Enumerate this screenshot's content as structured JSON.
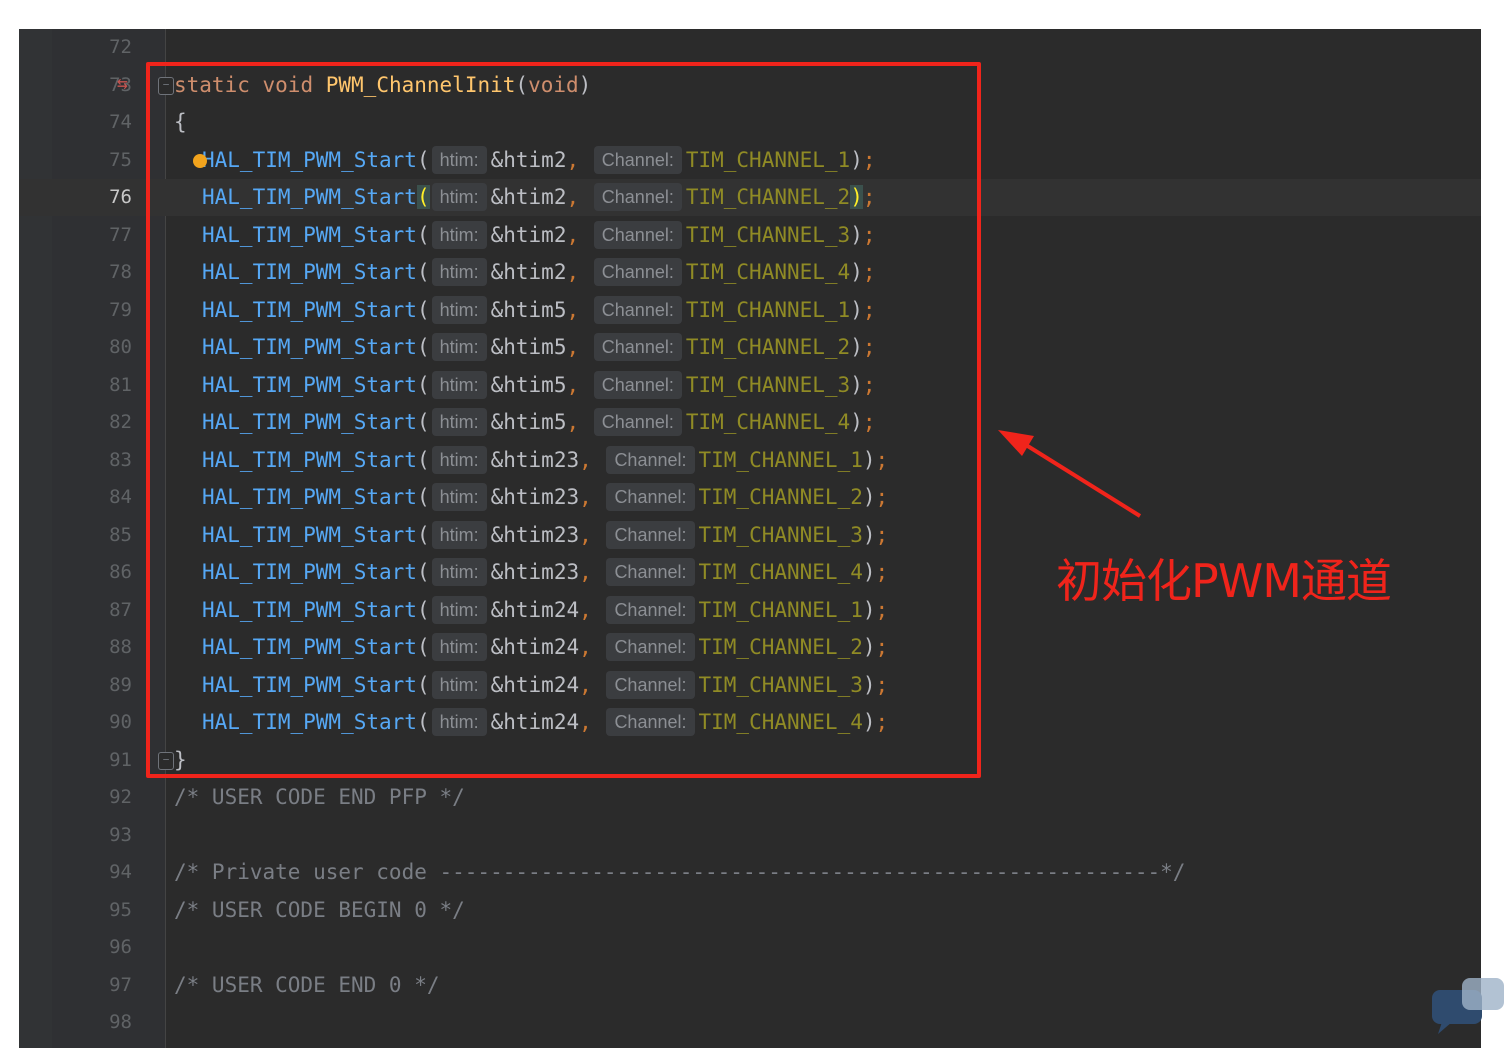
{
  "code": {
    "function_signature": {
      "line_number": "73",
      "keyword_static": "static",
      "keyword_void": "void",
      "function_name": "PWM_ChannelInit",
      "open_paren": "(",
      "param": "void",
      "close_paren": ")"
    },
    "open_brace": {
      "line_number": "74",
      "text": "{"
    },
    "hint_htim": "htim:",
    "hint_channel": "Channel:",
    "call_name": "HAL_TIM_PWM_Start",
    "calls": [
      {
        "line_number": "75",
        "timer": "&htim2",
        "channel": "TIM_CHANNEL_1"
      },
      {
        "line_number": "76",
        "timer": "&htim2",
        "channel": "TIM_CHANNEL_2"
      },
      {
        "line_number": "77",
        "timer": "&htim2",
        "channel": "TIM_CHANNEL_3"
      },
      {
        "line_number": "78",
        "timer": "&htim2",
        "channel": "TIM_CHANNEL_4"
      },
      {
        "line_number": "79",
        "timer": "&htim5",
        "channel": "TIM_CHANNEL_1"
      },
      {
        "line_number": "80",
        "timer": "&htim5",
        "channel": "TIM_CHANNEL_2"
      },
      {
        "line_number": "81",
        "timer": "&htim5",
        "channel": "TIM_CHANNEL_3"
      },
      {
        "line_number": "82",
        "timer": "&htim5",
        "channel": "TIM_CHANNEL_4"
      },
      {
        "line_number": "83",
        "timer": "&htim23",
        "channel": "TIM_CHANNEL_1"
      },
      {
        "line_number": "84",
        "timer": "&htim23",
        "channel": "TIM_CHANNEL_2"
      },
      {
        "line_number": "85",
        "timer": "&htim23",
        "channel": "TIM_CHANNEL_3"
      },
      {
        "line_number": "86",
        "timer": "&htim23",
        "channel": "TIM_CHANNEL_4"
      },
      {
        "line_number": "87",
        "timer": "&htim24",
        "channel": "TIM_CHANNEL_1"
      },
      {
        "line_number": "88",
        "timer": "&htim24",
        "channel": "TIM_CHANNEL_2"
      },
      {
        "line_number": "89",
        "timer": "&htim24",
        "channel": "TIM_CHANNEL_3"
      },
      {
        "line_number": "90",
        "timer": "&htim24",
        "channel": "TIM_CHANNEL_4"
      }
    ],
    "current_line": "76",
    "close_brace": {
      "line_number": "91",
      "text": "}"
    },
    "other_lines": [
      {
        "line_number": "72",
        "text": ""
      },
      {
        "line_number": "92",
        "text": "/* USER CODE END PFP */"
      },
      {
        "line_number": "93",
        "text": ""
      },
      {
        "line_number": "94",
        "text": "/* Private user code ---------------------------------------------------------*/"
      },
      {
        "line_number": "95",
        "text": "/* USER CODE BEGIN 0 */"
      },
      {
        "line_number": "96",
        "text": ""
      },
      {
        "line_number": "97",
        "text": "/* USER CODE END 0 */"
      },
      {
        "line_number": "98",
        "text": ""
      }
    ]
  },
  "annotation": {
    "label": "初始化PWM通道",
    "color": "#f0241b"
  },
  "icons": {
    "change_marker": "change-arrows-icon",
    "bulb": "intention-bulb-icon",
    "fold": "fold-icon",
    "watermark": "chat-bubble-icon"
  }
}
